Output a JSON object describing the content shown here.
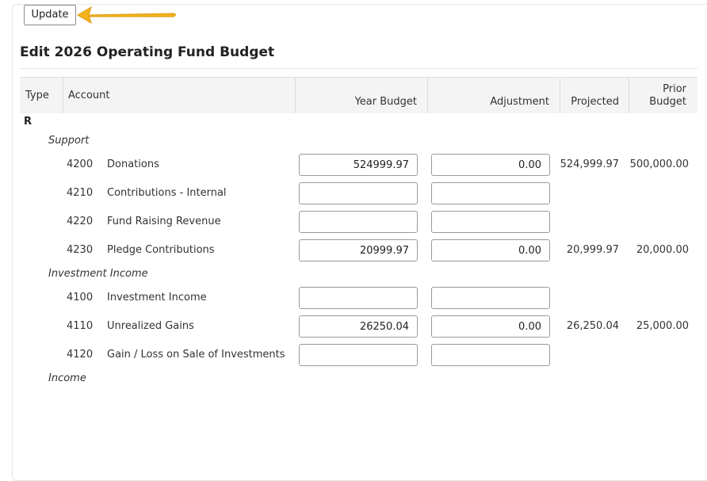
{
  "toolbar": {
    "update_label": "Update"
  },
  "page": {
    "title": "Edit 2026 Operating Fund Budget"
  },
  "table": {
    "headers": {
      "type": "Type",
      "account": "Account",
      "year_budget": "Year Budget",
      "adjustment": "Adjustment",
      "projected": "Projected",
      "prior_line1": "Prior",
      "prior_line2": "Budget"
    },
    "type_label": "R",
    "groups": [
      {
        "name": "Support",
        "rows": [
          {
            "number": "4200",
            "name": "Donations",
            "year_budget": "524999.97",
            "adjustment": "0.00",
            "projected": "524,999.97",
            "prior": "500,000.00"
          },
          {
            "number": "4210",
            "name": "Contributions - Internal",
            "year_budget": "",
            "adjustment": "",
            "projected": "",
            "prior": ""
          },
          {
            "number": "4220",
            "name": "Fund Raising Revenue",
            "year_budget": "",
            "adjustment": "",
            "projected": "",
            "prior": ""
          },
          {
            "number": "4230",
            "name": "Pledge Contributions",
            "year_budget": "20999.97",
            "adjustment": "0.00",
            "projected": "20,999.97",
            "prior": "20,000.00"
          }
        ]
      },
      {
        "name": "Investment Income",
        "rows": [
          {
            "number": "4100",
            "name": "Investment Income",
            "year_budget": "",
            "adjustment": "",
            "projected": "",
            "prior": ""
          },
          {
            "number": "4110",
            "name": "Unrealized Gains",
            "year_budget": "26250.04",
            "adjustment": "0.00",
            "projected": "26,250.04",
            "prior": "25,000.00"
          },
          {
            "number": "4120",
            "name": "Gain / Loss on Sale of Investments",
            "year_budget": "",
            "adjustment": "",
            "projected": "",
            "prior": ""
          }
        ]
      },
      {
        "name": "Income",
        "rows": []
      }
    ]
  },
  "colors": {
    "arrow": "#f5b41e",
    "header_bg": "#f4f4f4"
  }
}
